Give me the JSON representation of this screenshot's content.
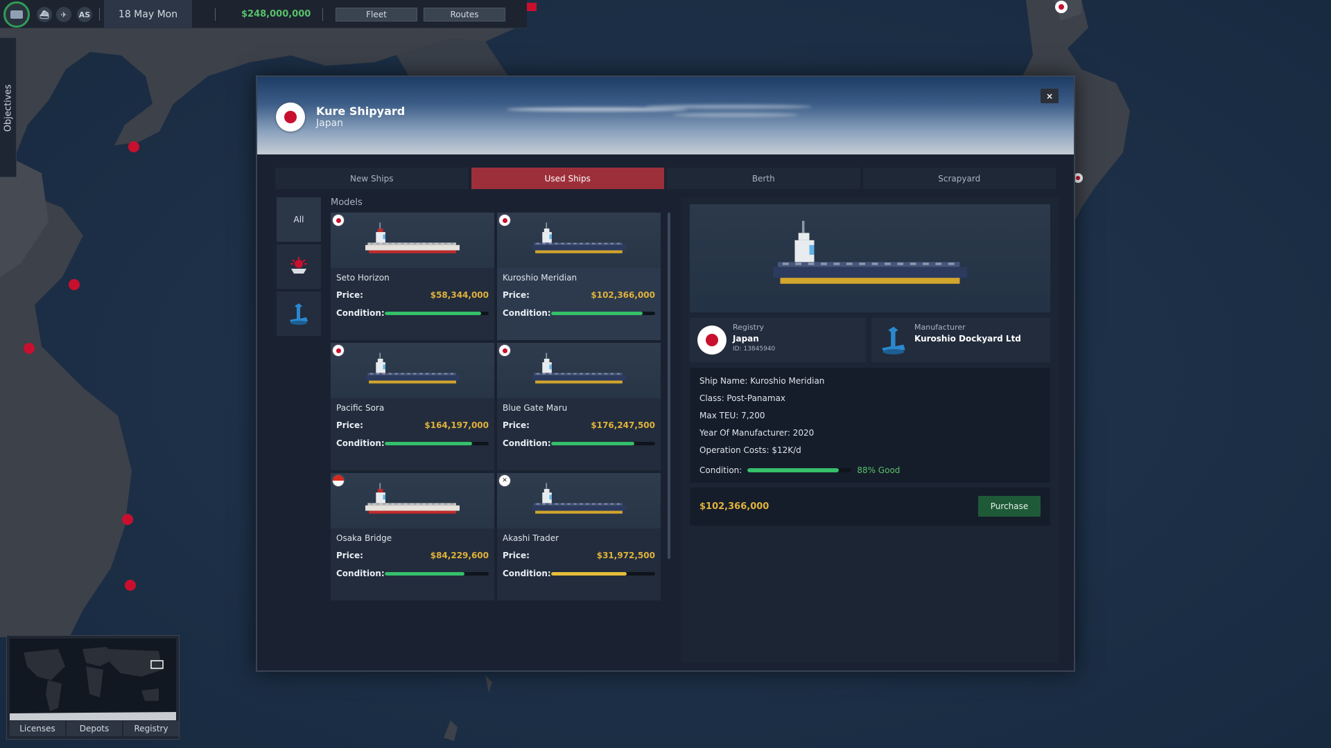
{
  "topbar": {
    "date": "18 May Mon",
    "money": "$248,000,000",
    "fleet_label": "Fleet",
    "routes_label": "Routes",
    "as_label": "AS"
  },
  "objectives_label": "Objectives",
  "minimap": {
    "buttons": [
      "Licenses",
      "Depots",
      "Registry"
    ]
  },
  "dialog": {
    "title": "Kure Shipyard",
    "subtitle": "Japan",
    "close_label": "×",
    "tabs": [
      "New Ships",
      "Used Ships",
      "Berth",
      "Scrapyard"
    ],
    "active_tab": "Used Ships",
    "filters": {
      "all_label": "All"
    },
    "models_label": "Models",
    "price_label": "Price:",
    "condition_label": "Condition:",
    "ships": [
      {
        "name": "Seto Horizon",
        "price": "$58,344,000",
        "condition": 0.93,
        "flag": "jp",
        "hull": "red"
      },
      {
        "name": "Kuroshio Meridian",
        "price": "$102,366,000",
        "condition": 0.88,
        "flag": "jp",
        "hull": "gold"
      },
      {
        "name": "Pacific Sora",
        "price": "$164,197,000",
        "condition": 0.84,
        "flag": "jp",
        "hull": "gold"
      },
      {
        "name": "Blue Gate Maru",
        "price": "$176,247,500",
        "condition": 0.8,
        "flag": "jp",
        "hull": "gold"
      },
      {
        "name": "Osaka Bridge",
        "price": "$84,229,600",
        "condition": 0.77,
        "flag": "sg",
        "hull": "red"
      },
      {
        "name": "Akashi Trader",
        "price": "$31,972,500",
        "condition": 0.73,
        "flag": "kr",
        "hull": "gold"
      }
    ],
    "details": {
      "registry_label": "Registry",
      "registry_value": "Japan",
      "registry_id": "ID: 13845940",
      "manufacturer_label": "Manufacturer",
      "manufacturer_value": "Kuroshio Dockyard Ltd",
      "ship_name": "Ship Name: Kuroshio Meridian",
      "class": "Class: Post-Panamax",
      "max_teu": "Max TEU: 7,200",
      "year": "Year Of Manufacturer: 2020",
      "op_costs": "Operation Costs: $12K/d",
      "condition_label": "Condition:",
      "condition_value": 0.88,
      "condition_text": "88% Good",
      "price": "$102,366,000",
      "purchase_label": "Purchase"
    }
  },
  "colors": {
    "accent_red": "#9d2f3a",
    "money_green": "#58c06a",
    "price_gold": "#e0b23b",
    "condition_good": "#35c06a",
    "condition_warn": "#e6bc3b"
  }
}
